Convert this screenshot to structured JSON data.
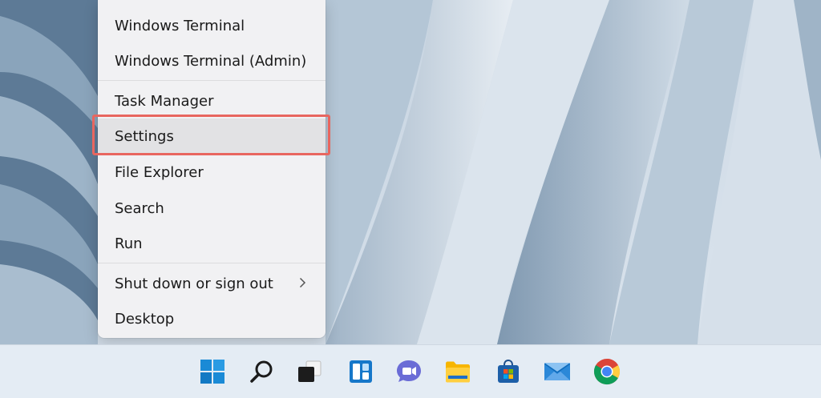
{
  "context_menu": {
    "items": [
      {
        "label": "Windows Terminal"
      },
      {
        "label": "Windows Terminal (Admin)"
      },
      {
        "label": "Task Manager"
      },
      {
        "label": "Settings"
      },
      {
        "label": "File Explorer"
      },
      {
        "label": "Search"
      },
      {
        "label": "Run"
      },
      {
        "label": "Shut down or sign out"
      },
      {
        "label": "Desktop"
      }
    ],
    "highlight_color": "#e8665f"
  },
  "taskbar": {
    "icons": [
      "windows-start-icon",
      "search-icon",
      "task-view-icon",
      "widgets-icon",
      "chat-icon",
      "file-explorer-icon",
      "microsoft-store-icon",
      "mail-icon",
      "chrome-icon"
    ]
  }
}
